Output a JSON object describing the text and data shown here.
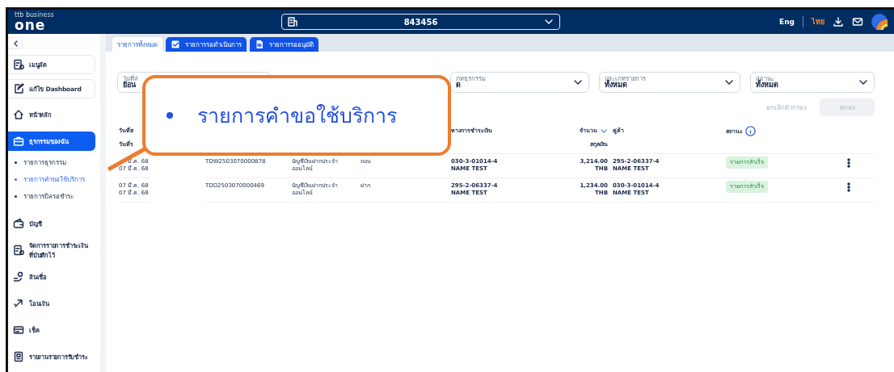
{
  "header": {
    "logo_small": "ttb business",
    "logo": "one",
    "account": "843456",
    "languages": [
      {
        "label": "Eng",
        "selected": false
      },
      {
        "label": "ไทย",
        "selected": true
      }
    ]
  },
  "sidebar": {
    "items": [
      {
        "kind": "card",
        "label": "เมนูลัด",
        "selected": false
      },
      {
        "kind": "card",
        "label": "แก้ไข Dashboard",
        "selected": false
      },
      {
        "kind": "link",
        "label": "หน้าหลัก",
        "selected": false
      },
      {
        "kind": "link",
        "label": "ธุรกรรมของฉัน",
        "selected": true,
        "children": [
          {
            "label": "รายการธุรกรรม",
            "selected": false
          },
          {
            "label": "รายการคำขอใช้บริการ",
            "selected": true
          },
          {
            "label": "รายการบิลรอชำระ",
            "selected": false
          }
        ]
      },
      {
        "kind": "link",
        "label": "บัญชี",
        "selected": false
      },
      {
        "kind": "link",
        "label": "จัดการรายการชำระเงิน ที่บันทึกไว้",
        "selected": false
      },
      {
        "kind": "link",
        "label": "สินเชื่อ",
        "selected": false
      },
      {
        "kind": "link",
        "label": "โอนเงิน",
        "selected": false
      },
      {
        "kind": "link",
        "label": "เช็ค",
        "selected": false
      },
      {
        "kind": "link",
        "label": "รายงานรายการรับชำระ",
        "selected": false
      }
    ]
  },
  "tabs": [
    {
      "label": "รายการทั้งหมด",
      "selected": true
    },
    {
      "label": "รายการรอดำเนินการ",
      "selected": false
    },
    {
      "label": "รายการรออนุมัติ",
      "selected": false
    }
  ],
  "filters": [
    {
      "label": "วันที่ส",
      "value": "ย้อน"
    },
    {
      "label": "ภทธุรกรรม",
      "value": "ด"
    },
    {
      "label": "ประเภทรายการ",
      "value": "ทั้งหมด"
    },
    {
      "label": "สถานะ",
      "value": "ทั้งหมด"
    }
  ],
  "filter_buttons": {
    "clear": "ยกเลิกตัวกรอง",
    "apply": "ตกลง",
    "apply_disabled": true
  },
  "table": {
    "columns": [
      {
        "kind": "date",
        "lines": [
          "วันที่ส",
          "วันที่ร"
        ]
      },
      {
        "kind": "channel",
        "lines": [
          "ทางการชำระเงิน"
        ]
      },
      {
        "kind": "amount",
        "lines": [
          "จำนวน",
          "สกุลเงิน"
        ],
        "sortable": true
      },
      {
        "kind": "party",
        "lines": [
          "คู่ค้า"
        ]
      },
      {
        "kind": "status",
        "lines": [
          "สถานะ"
        ],
        "info": true
      }
    ],
    "rows": [
      {
        "dates": [
          "มี.ค. 68",
          "07 มี.ค. 68"
        ],
        "reference": "TDW2503070000878",
        "account": [
          "บัญชีเงินฝากประจำ",
          "ออนไลน์"
        ],
        "type": "ถอน",
        "channel": [
          "030-3-01014-4",
          "NAME TEST"
        ],
        "amount": "3,214.00",
        "currency": "THB",
        "party": [
          "295-2-06337-4",
          "NAME TEST"
        ],
        "status": "รายการสำเร็จ"
      },
      {
        "dates": [
          "07 มี.ค. 68",
          "07 มี.ค. 68"
        ],
        "reference": "TDD2503070000469",
        "account": [
          "บัญชีเงินฝากประจำ",
          "ออนไลน์"
        ],
        "type": "ฝาก",
        "channel": [
          "295-2-06337-4",
          "NAME TEST"
        ],
        "amount": "1,234.00",
        "currency": "THB",
        "party": [
          "030-3-01014-4",
          "NAME TEST"
        ],
        "status": "รายการสำเร็จ"
      }
    ]
  },
  "callout": {
    "text": "รายการคำขอใช้บริการ"
  }
}
